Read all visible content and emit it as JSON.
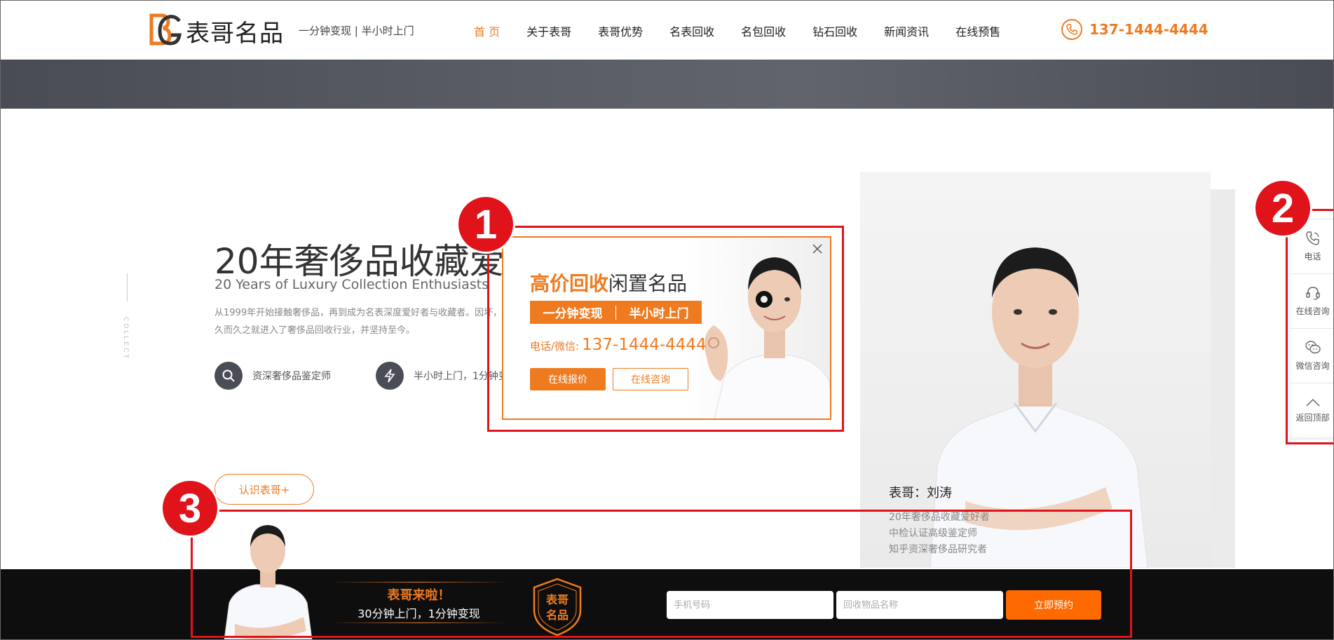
{
  "header": {
    "logo_text": "表哥名品",
    "slogan": "一分钟变现 | 半小时上门",
    "nav": [
      "首 页",
      "关于表哥",
      "表哥优势",
      "名表回收",
      "名包回收",
      "钻石回收",
      "新闻资讯",
      "在线预售"
    ],
    "phone": "137-1444-4444"
  },
  "about": {
    "side_text": "COLLECT",
    "title": "20年奢侈品收藏爱好",
    "subtitle": "20 Years of Luxury Collection Enthusiasts",
    "desc": "从1999年开始接触奢侈品，再到成为名表深度爱好者与收藏者。因坏，久而久之就进入了奢侈品回收行业，并坚持至今。",
    "features": [
      "资深奢侈品鉴定师",
      "半小时上门，1分钟变"
    ],
    "button": "认识表哥+"
  },
  "profile": {
    "name": "表哥：刘涛",
    "lines": [
      "20年奢侈品收藏爱好者",
      "中检认证高级鉴定师",
      "知乎资深奢侈品研究者"
    ]
  },
  "popup": {
    "title_highlight": "高价回收",
    "title_rest": "闲置名品",
    "tag1": "一分钟变现",
    "tag2": "半小时上门",
    "tel_label": "电话/微信:",
    "tel_number": "137-1444-4444",
    "btn_quote": "在线报价",
    "btn_consult": "在线咨询"
  },
  "sidebar": [
    {
      "label": "电话",
      "icon": "phone-icon"
    },
    {
      "label": "在线咨询",
      "icon": "headset-icon"
    },
    {
      "label": "微信咨询",
      "icon": "wechat-icon"
    },
    {
      "label": "返回顶部",
      "icon": "chevron-up-icon"
    }
  ],
  "bottom_bar": {
    "title": "表哥来啦！",
    "subtitle": "30分钟上门，1分钟变现",
    "badge_line1": "表哥",
    "badge_line2": "名品",
    "phone_placeholder": "手机号码",
    "item_placeholder": "回收物品名称",
    "submit": "立即预约"
  },
  "annotations": [
    "1",
    "2",
    "3"
  ],
  "colors": {
    "accent": "#ef7b21",
    "annotation": "#e0131b",
    "banner": "#4a4d56"
  }
}
